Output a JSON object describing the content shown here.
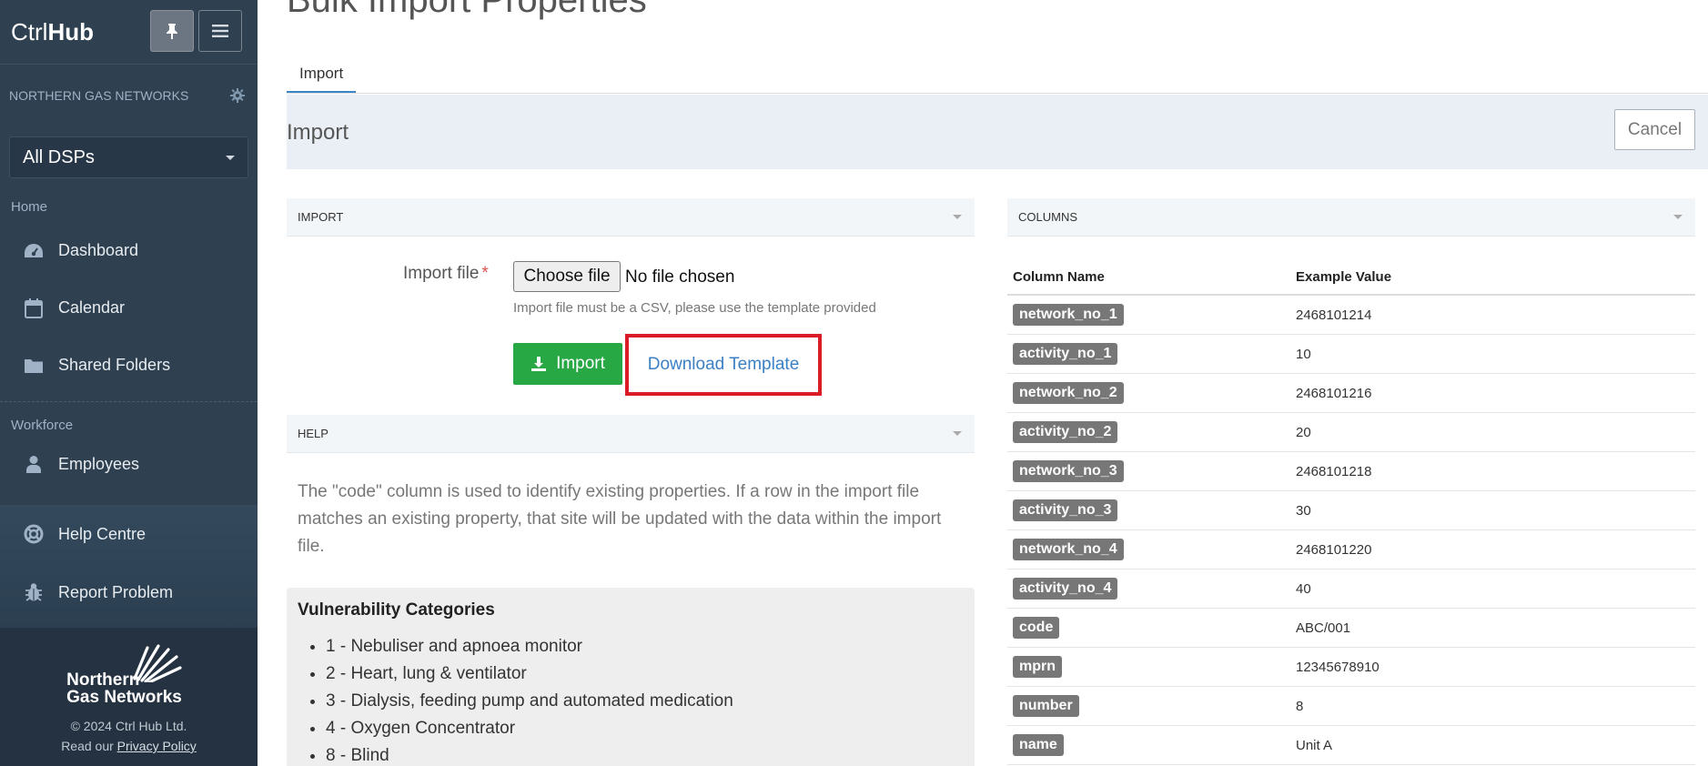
{
  "sidebar": {
    "brand_light": "Ctrl",
    "brand_bold": "Hub",
    "org_name": "NORTHERN GAS NETWORKS",
    "dsp_select": "All DSPs",
    "sections": {
      "home": "Home",
      "workforce": "Workforce"
    },
    "items": {
      "dashboard": "Dashboard",
      "calendar": "Calendar",
      "shared_folders": "Shared Folders",
      "employees": "Employees",
      "help_centre": "Help Centre",
      "report_problem": "Report Problem"
    },
    "footer": {
      "logo_line1": "Northern",
      "logo_line2": "Gas Networks",
      "copyright": "© 2024 Ctrl Hub Ltd.",
      "policy_prefix": "Read our ",
      "policy_link": "Privacy Policy"
    }
  },
  "main": {
    "page_title": "Bulk Import Properties",
    "tab_label": "Import",
    "band_title": "Import",
    "cancel_label": "Cancel",
    "import_panel": {
      "heading": "IMPORT",
      "file_label": "Import file",
      "required_mark": "*",
      "choose_file": "Choose file",
      "no_file": "No file chosen",
      "hint": "Import file must be a CSV, please use the template provided",
      "import_button": "Import",
      "download_link": "Download Template"
    },
    "help_panel": {
      "heading": "HELP",
      "paragraph": "The \"code\" column is used to identify existing properties. If a row in the import file matches an existing property, that site will be updated with the data within the import file.",
      "vuln_title": "Vulnerability Categories",
      "vuln_items": [
        "1 - Nebuliser and apnoea monitor",
        "2 - Heart, lung & ventilator",
        "3 - Dialysis, feeding pump and automated medication",
        "4 - Oxygen Concentrator",
        "8 - Blind"
      ]
    },
    "columns_panel": {
      "heading": "COLUMNS",
      "header_name": "Column Name",
      "header_example": "Example Value",
      "rows": [
        {
          "name": "network_no_1",
          "example": "2468101214"
        },
        {
          "name": "activity_no_1",
          "example": "10"
        },
        {
          "name": "network_no_2",
          "example": "2468101216"
        },
        {
          "name": "activity_no_2",
          "example": "20"
        },
        {
          "name": "network_no_3",
          "example": "2468101218"
        },
        {
          "name": "activity_no_3",
          "example": "30"
        },
        {
          "name": "network_no_4",
          "example": "2468101220"
        },
        {
          "name": "activity_no_4",
          "example": "40"
        },
        {
          "name": "code",
          "example": "ABC/001"
        },
        {
          "name": "mprn",
          "example": "12345678910"
        },
        {
          "name": "number",
          "example": "8"
        },
        {
          "name": "name",
          "example": "Unit A"
        }
      ]
    }
  },
  "colors": {
    "sidebar_bg": "#2f4050",
    "accent_blue": "#3b86c9",
    "import_green": "#28a745",
    "highlight_red": "#d91c26",
    "badge_gray": "#777777"
  }
}
